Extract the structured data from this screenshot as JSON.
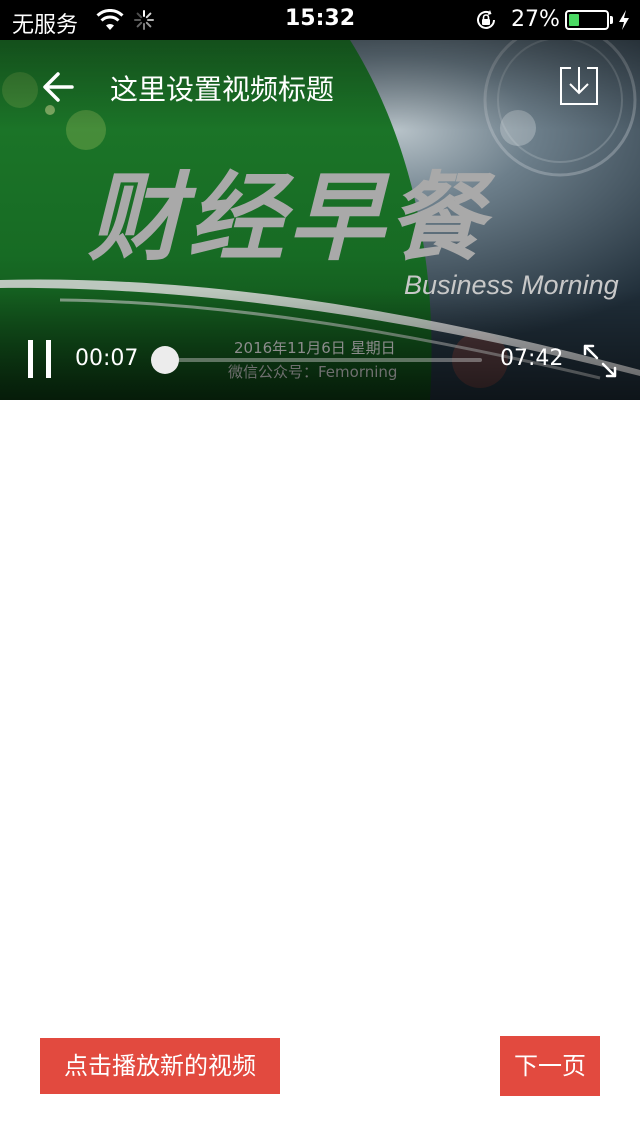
{
  "status_bar": {
    "carrier": "无服务",
    "time": "15:32",
    "battery_percent": "27%",
    "battery_level": 0.27,
    "battery_fill_color": "#4cd964",
    "icons": [
      "wifi-icon",
      "activity-spinner-icon",
      "rotation-lock-icon",
      "battery-icon",
      "charging-bolt-icon"
    ]
  },
  "player": {
    "title": "这里设置视频标题",
    "current_time": "00:07",
    "total_time": "07:42",
    "progress_fraction": 0.015,
    "icons": [
      "back-arrow-icon",
      "download-icon",
      "pause-icon",
      "fullscreen-icon"
    ],
    "video_frame": {
      "title_cn": "财经早餐",
      "title_en": "Business Morning",
      "date": "2016年11月6日 星期日",
      "wechat": "微信公众号：Femorning"
    }
  },
  "buttons": {
    "play_new_video": "点击播放新的视频",
    "next_page": "下一页",
    "color": "#e24a3f"
  }
}
